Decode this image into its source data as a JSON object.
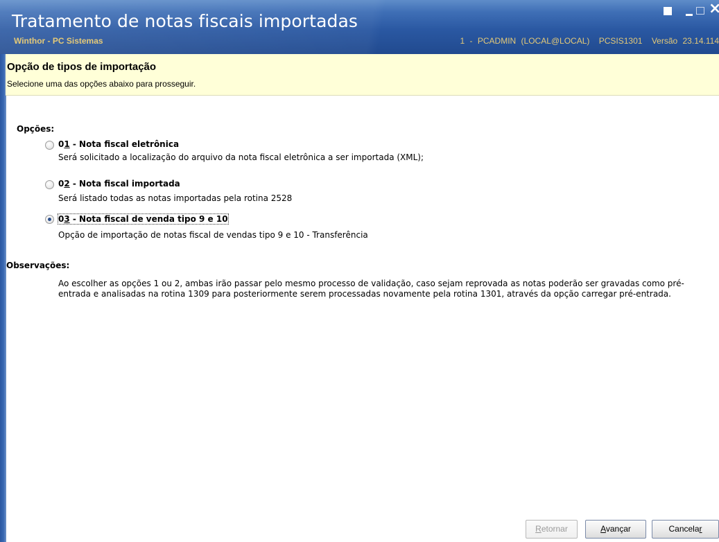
{
  "window": {
    "title": "Tratamento de notas fiscais importadas",
    "subtitle": "Winthor - PC Sistemas",
    "status": {
      "user": "1 - PCADMIN (LOCAL@LOCAL)",
      "routine": "PCSIS1301",
      "version": "Versão 23.14.114"
    },
    "controls": {
      "close": "×"
    }
  },
  "header": {
    "title": "Opção de tipos de importação",
    "description": "Selecione uma das opções abaixo para prosseguir."
  },
  "options_section": {
    "label": "Opções:",
    "items": [
      {
        "code_prefix": "0",
        "code_hotkey": "1",
        "title": " - Nota fiscal eletrônica",
        "description": "Será solicitado a localização do arquivo da nota fiscal eletrônica a ser importada (XML);",
        "selected": false
      },
      {
        "code_prefix": "0",
        "code_hotkey": "2",
        "title": " - Nota fiscal importada",
        "description": "Será listado todas as notas importadas pela rotina 2528",
        "selected": false
      },
      {
        "code_prefix": "0",
        "code_hotkey": "3",
        "title": " - Nota fiscal de venda tipo 9 e 10",
        "description": "Opção de importação de notas fiscal de vendas tipo 9 e 10 - Transferência",
        "selected": true
      }
    ]
  },
  "observations": {
    "label": "Observações:",
    "text": "Ao escolher as opções 1 ou 2, ambas irão passar pelo mesmo processo de validação, caso sejam reprovada as notas poderão ser gravadas como pré-entrada e analisadas na rotina 1309 para posteriormente serem processadas novamente pela rotina 1301, através da opção carregar pré-entrada."
  },
  "footer": {
    "back": {
      "hotkey": "R",
      "rest": "etornar",
      "enabled": false
    },
    "next": {
      "hotkey": "A",
      "rest": "vançar",
      "enabled": true
    },
    "cancel": {
      "before": "Cancela",
      "hotkey": "r",
      "enabled": true
    }
  },
  "colors": {
    "titlebar": "#2a58a2",
    "subtitle": "#e4c978",
    "header_bg": "#ffffd8"
  }
}
